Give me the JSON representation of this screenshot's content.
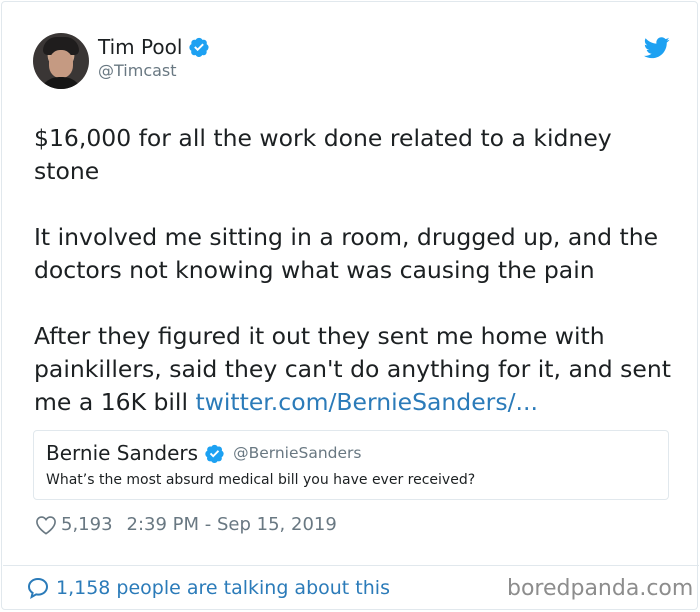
{
  "author": {
    "name": "Tim Pool",
    "handle": "@Timcast"
  },
  "tweet": {
    "paragraphs": [
      "$16,000 for all the work done related to a kidney stone",
      "It involved me sitting in a room, drugged up, and the doctors not knowing what was causing the pain",
      "After they figured it out they sent me home with painkillers, said they can't do anything for it, and sent me a 16K bill "
    ],
    "link_text": "twitter.com/BernieSanders/..."
  },
  "quoted_tweet": {
    "name": "Bernie Sanders",
    "handle": "@BernieSanders",
    "text": "What’s the most absurd medical bill you have ever received?"
  },
  "meta": {
    "likes": "5,193",
    "timestamp": "2:39 PM - Sep 15, 2019"
  },
  "footer": {
    "talking": "1,158 people are talking about this",
    "watermark": "boredpanda.com"
  },
  "colors": {
    "verified": "#1da1f2",
    "link": "#2b7bb9",
    "muted": "#697882"
  },
  "icons": [
    "verified-icon",
    "twitter-bird-icon",
    "heart-icon",
    "reply-bubble-icon"
  ]
}
